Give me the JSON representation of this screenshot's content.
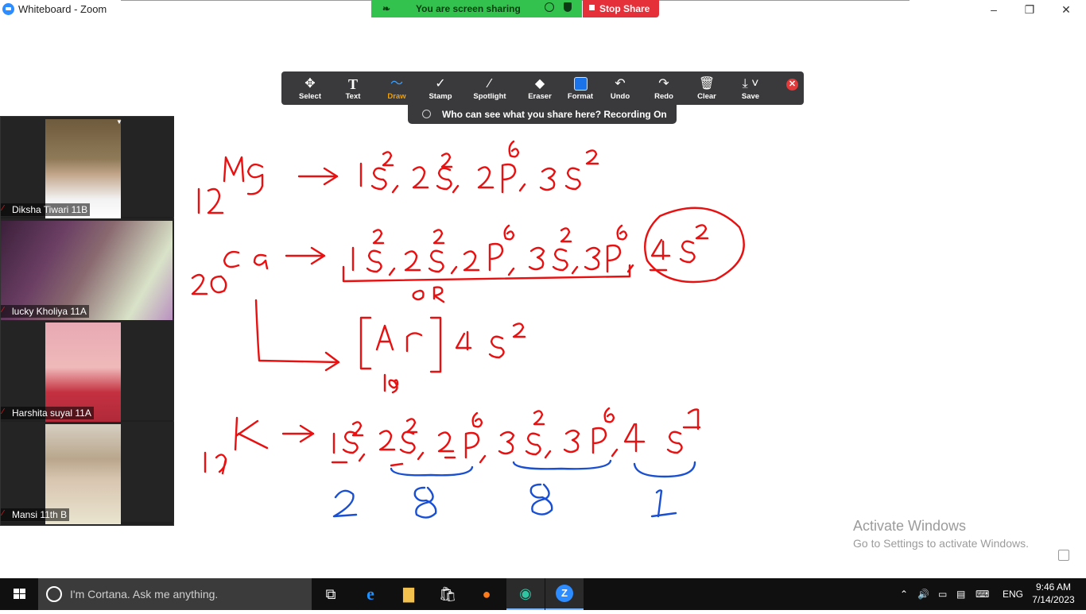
{
  "window": {
    "title": "Whiteboard - Zoom",
    "controls": [
      "–",
      "❐",
      "✕"
    ]
  },
  "sharing": {
    "banner_text": "You are screen sharing",
    "stop_label": "Stop Share"
  },
  "toolbar": {
    "tools": [
      {
        "label": "Select",
        "icon": "move-icon"
      },
      {
        "label": "Text",
        "icon": "text-icon"
      },
      {
        "label": "Draw",
        "icon": "draw-icon",
        "active": true
      },
      {
        "label": "Stamp",
        "icon": "stamp-icon"
      },
      {
        "label": "Spotlight",
        "icon": "spotlight-icon"
      },
      {
        "label": "Eraser",
        "icon": "eraser-icon"
      },
      {
        "label": "Format",
        "icon": "format-icon"
      },
      {
        "label": "Undo",
        "icon": "undo-icon"
      },
      {
        "label": "Redo",
        "icon": "redo-icon"
      },
      {
        "label": "Clear",
        "icon": "trash-icon"
      },
      {
        "label": "Save",
        "icon": "save-icon"
      }
    ],
    "who_can_see": "Who can see what you share here? Recording On",
    "active_color": "#f4a100"
  },
  "participants": [
    {
      "name": "Diksha Tiwari 11B"
    },
    {
      "name": "lucky Kholiya 11A"
    },
    {
      "name": "Harshita suyal 11A"
    },
    {
      "name": "Mansi 11th B"
    }
  ],
  "watermark": {
    "line1": "Activate Windows",
    "line2": "Go to Settings to activate Windows."
  },
  "taskbar": {
    "search_placeholder": "I'm Cortana. Ask me anything.",
    "language": "ENG",
    "time": "9:46 AM",
    "date": "7/14/2023"
  },
  "ink_colors": {
    "red": "#e81010",
    "blue": "#1a4fd1"
  }
}
